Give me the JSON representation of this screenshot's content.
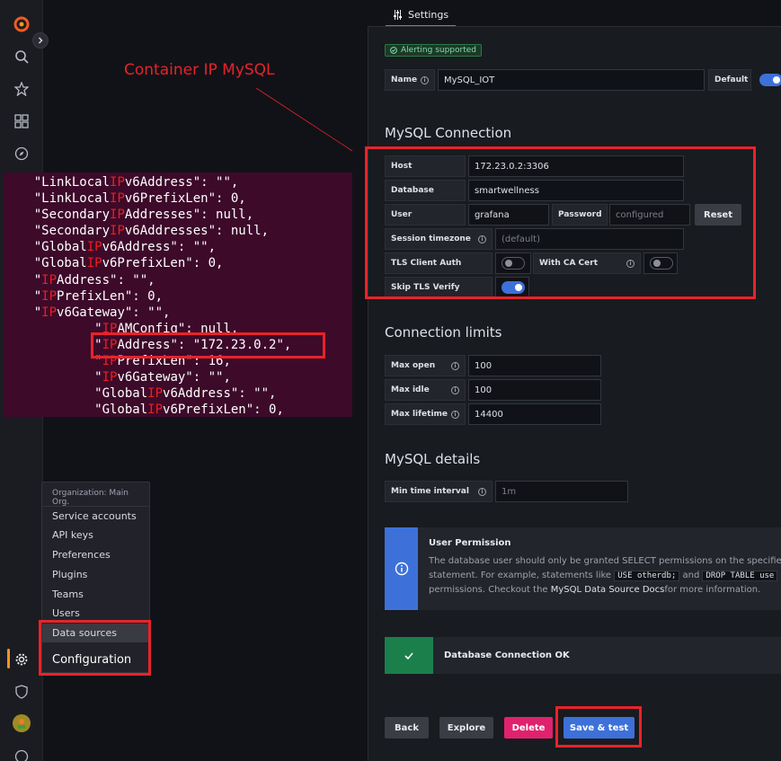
{
  "annotation": {
    "title": "Container IP MySQL"
  },
  "json_snippet": {
    "lines": [
      [
        {
          "t": "    \"LinkLocal"
        },
        {
          "t": "IP",
          "h": true
        },
        {
          "t": "v6Address\": \"\","
        }
      ],
      [
        {
          "t": "    \"LinkLocal"
        },
        {
          "t": "IP",
          "h": true
        },
        {
          "t": "v6PrefixLen\": 0,"
        }
      ],
      [
        {
          "t": "    \"Secondary"
        },
        {
          "t": "IP",
          "h": true
        },
        {
          "t": "Addresses\": null,"
        }
      ],
      [
        {
          "t": "    \"Secondary"
        },
        {
          "t": "IP",
          "h": true
        },
        {
          "t": "v6Addresses\": null,"
        }
      ],
      [
        {
          "t": "    \"Global"
        },
        {
          "t": "IP",
          "h": true
        },
        {
          "t": "v6Address\": \"\","
        }
      ],
      [
        {
          "t": "    \"Global"
        },
        {
          "t": "IP",
          "h": true
        },
        {
          "t": "v6PrefixLen\": 0,"
        }
      ],
      [
        {
          "t": "    \""
        },
        {
          "t": "IP",
          "h": true
        },
        {
          "t": "Address\": \"\","
        }
      ],
      [
        {
          "t": "    \""
        },
        {
          "t": "IP",
          "h": true
        },
        {
          "t": "PrefixLen\": 0,"
        }
      ],
      [
        {
          "t": "    \""
        },
        {
          "t": "IP",
          "h": true
        },
        {
          "t": "v6Gateway\": \"\","
        }
      ],
      [
        {
          "t": "            \""
        },
        {
          "t": "IP",
          "h": true
        },
        {
          "t": "AMConfig\": null,"
        }
      ],
      [
        {
          "t": "            \""
        },
        {
          "t": "IP",
          "h": true
        },
        {
          "t": "Address\": \"172.23.0.2\","
        }
      ],
      [
        {
          "t": "            \""
        },
        {
          "t": "IP",
          "h": true
        },
        {
          "t": "PrefixLen\": 16,"
        }
      ],
      [
        {
          "t": "            \""
        },
        {
          "t": "IP",
          "h": true
        },
        {
          "t": "v6Gateway\": \"\","
        }
      ],
      [
        {
          "t": "            \"Global"
        },
        {
          "t": "IP",
          "h": true
        },
        {
          "t": "v6Address\": \"\","
        }
      ],
      [
        {
          "t": "            \"Global"
        },
        {
          "t": "IP",
          "h": true
        },
        {
          "t": "v6PrefixLen\": 0,"
        }
      ]
    ]
  },
  "org_menu": {
    "header": "Organization: Main Org.",
    "items": [
      "Service accounts",
      "API keys",
      "Preferences",
      "Plugins",
      "Teams",
      "Users",
      "Data sources"
    ],
    "footer": "Configuration"
  },
  "tab": {
    "label": "Settings"
  },
  "badge": "Alerting supported",
  "name_row": {
    "label": "Name",
    "value": "MySQL_IOT",
    "default_label": "Default",
    "default_on": true
  },
  "connection": {
    "title": "MySQL Connection",
    "host_label": "Host",
    "host": "172.23.0.2:3306",
    "database_label": "Database",
    "database": "smartwellness",
    "user_label": "User",
    "user": "grafana",
    "password_label": "Password",
    "password_placeholder": "configured",
    "reset_label": "Reset",
    "timezone_label": "Session timezone",
    "timezone_placeholder": "(default)",
    "tls_client_label": "TLS Client Auth",
    "tls_client_on": false,
    "ca_cert_label": "With CA Cert",
    "ca_cert_on": false,
    "skip_tls_label": "Skip TLS Verify",
    "skip_tls_on": true
  },
  "limits": {
    "title": "Connection limits",
    "max_open_label": "Max open",
    "max_open": "100",
    "max_idle_label": "Max idle",
    "max_idle": "100",
    "max_lifetime_label": "Max lifetime",
    "max_lifetime": "14400"
  },
  "details": {
    "title": "MySQL details",
    "min_interval_label": "Min time interval",
    "min_interval_placeholder": "1m"
  },
  "permission_alert": {
    "title": "User Permission",
    "line1": "The database user should only be granted SELECT permissions on the specified",
    "line2_pre": "statement. For example, statements like ",
    "code1": "USE otherdb;",
    "line2_mid": " and ",
    "code2": "DROP TABLE use",
    "line3_pre": "permissions. Checkout the ",
    "link": "MySQL Data Source Docs",
    "line3_post": "for more information."
  },
  "success_alert": {
    "title": "Database Connection OK"
  },
  "buttons": {
    "back": "Back",
    "explore": "Explore",
    "delete": "Delete",
    "save": "Save & test"
  },
  "colors": {
    "accent_red": "#e8232a",
    "primary": "#3d71d9",
    "danger": "#e0226e",
    "success": "#1a7f4b",
    "info": "#3d71d9"
  }
}
